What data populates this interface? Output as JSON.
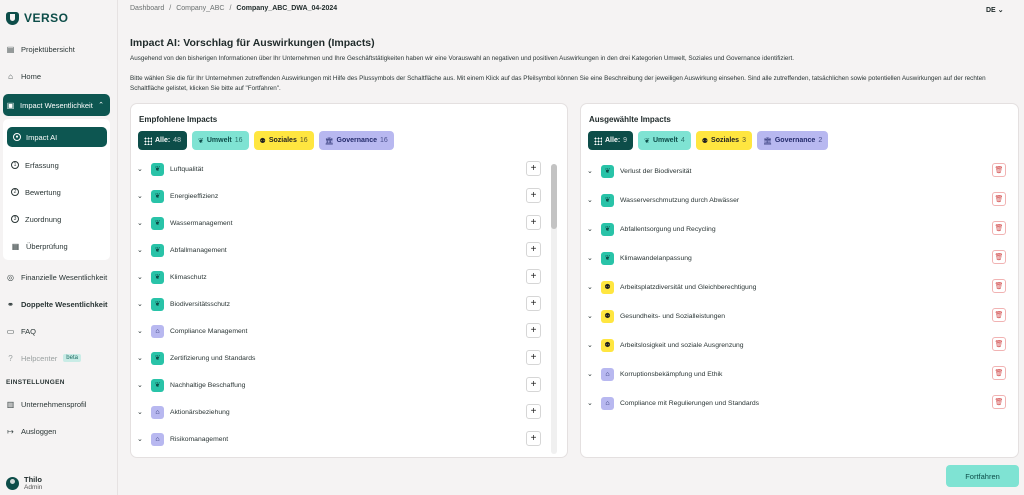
{
  "brand": {
    "name": "VERSO"
  },
  "sidebar": {
    "items": [
      {
        "label": "Projektübersicht",
        "icon": "project-overview-icon"
      },
      {
        "label": "Home",
        "icon": "home-icon"
      },
      {
        "label": "Impact Wesentlichkeit",
        "icon": "impact-icon"
      },
      {
        "label": "Finanzielle Wesentlichkeit",
        "icon": "finance-icon"
      },
      {
        "label": "Doppelte Wesentlichkeit",
        "icon": "double-materiality-icon"
      },
      {
        "label": "FAQ",
        "icon": "faq-icon"
      },
      {
        "label": "Helpcenter",
        "icon": "help-icon",
        "badge": "beta"
      }
    ],
    "subitems": [
      {
        "label": "Impact AI"
      },
      {
        "label": "Erfassung"
      },
      {
        "label": "Bewertung"
      },
      {
        "label": "Zuordnung"
      },
      {
        "label": "Überprüfung"
      }
    ],
    "settings_label": "EINSTELLUNGEN",
    "settings": [
      {
        "label": "Unternehmensprofil"
      },
      {
        "label": "Ausloggen"
      }
    ],
    "user": {
      "name": "Thilo",
      "role": "Admin"
    }
  },
  "breadcrumb": [
    "Dashboard",
    "Company_ABC",
    "Company_ABC_DWA_04-2024"
  ],
  "language": "DE",
  "page": {
    "title": "Impact AI: Vorschlag für Auswirkungen (Impacts)",
    "intro1": "Ausgehend von den bisherigen Informationen über Ihr Unternehmen und Ihre Geschäftstätigkeiten haben wir eine Vorauswahl an negativen und positiven Auswirkungen in den drei Kategorien Umwelt, Soziales und Governance identifiziert.",
    "intro2": "Bitte wählen Sie die für Ihr Unternehmen zutreffenden Auswirkungen mit Hilfe des Plussymbols der Schaltfläche aus. Mit einem Klick auf das Pfeilsymbol können Sie eine Beschreibung der jeweiligen Auswirkung einsehen. Sind alle zutreffenden, tatsächlichen sowie potentiellen Auswirkungen auf der rechten Schaltfläche gelistet, klicken Sie bitte auf \"Fortfahren\"."
  },
  "left": {
    "title": "Empfohlene Impacts",
    "chips": {
      "all": {
        "label": "Alle:",
        "count": "48"
      },
      "env": {
        "label": "Umwelt",
        "count": "16"
      },
      "soc": {
        "label": "Soziales",
        "count": "16"
      },
      "gov": {
        "label": "Governance",
        "count": "16"
      }
    },
    "items": [
      {
        "label": "Luftqualität",
        "cat": "env"
      },
      {
        "label": "Energieeffizienz",
        "cat": "env"
      },
      {
        "label": "Wassermanagement",
        "cat": "env"
      },
      {
        "label": "Abfallmanagement",
        "cat": "env"
      },
      {
        "label": "Klimaschutz",
        "cat": "env"
      },
      {
        "label": "Biodiversitätsschutz",
        "cat": "env"
      },
      {
        "label": "Compliance Management",
        "cat": "gov"
      },
      {
        "label": "Zertifizierung und Standards",
        "cat": "env"
      },
      {
        "label": "Nachhaltige Beschaffung",
        "cat": "env"
      },
      {
        "label": "Aktionärsbeziehung",
        "cat": "gov"
      },
      {
        "label": "Risikomanagement",
        "cat": "gov"
      }
    ]
  },
  "right": {
    "title": "Ausgewählte Impacts",
    "chips": {
      "all": {
        "label": "Alle:",
        "count": "9"
      },
      "env": {
        "label": "Umwelt",
        "count": "4"
      },
      "soc": {
        "label": "Soziales",
        "count": "3"
      },
      "gov": {
        "label": "Governance",
        "count": "2"
      }
    },
    "items": [
      {
        "label": "Verlust der Biodiversität",
        "cat": "env"
      },
      {
        "label": "Wasserverschmutzung durch Abwässer",
        "cat": "env"
      },
      {
        "label": "Abfallentsorgung und Recycling",
        "cat": "env"
      },
      {
        "label": "Klimawandelanpassung",
        "cat": "env"
      },
      {
        "label": "Arbeitsplatzdiversität und Gleichberechtigung",
        "cat": "soc"
      },
      {
        "label": "Gesundheits- und Sozialleistungen",
        "cat": "soc"
      },
      {
        "label": "Arbeitslosigkeit und soziale Ausgrenzung",
        "cat": "soc"
      },
      {
        "label": "Korruptionsbekämpfung und Ethik",
        "cat": "gov"
      },
      {
        "label": "Compliance mit Regulierungen und Standards",
        "cat": "gov"
      }
    ]
  },
  "actions": {
    "continue_label": "Fortfahren"
  },
  "colors": {
    "accent": "#0d5651",
    "env": "#29c3a8",
    "soc": "#ffe640",
    "gov": "#b8b8f0"
  }
}
